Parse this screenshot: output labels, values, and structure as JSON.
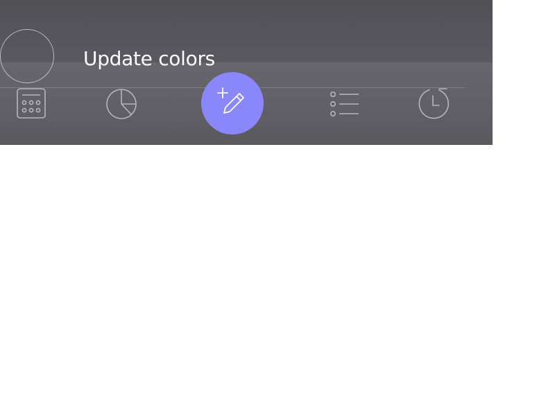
{
  "tooltip": {
    "label": "Update colors"
  },
  "colors": {
    "accent": "#8a87fb",
    "icon_stroke": "#b7b6bb",
    "panel_background": "#5e5d63"
  },
  "tab_bar": {
    "tabs": [
      {
        "name": "calculator-tab",
        "icon": "calculator-icon"
      },
      {
        "name": "statistics-tab",
        "icon": "pie-chart-icon"
      },
      {
        "name": "add-entry-tab",
        "icon": "add-edit-icon"
      },
      {
        "name": "list-tab",
        "icon": "list-icon"
      },
      {
        "name": "history-tab",
        "icon": "history-icon"
      }
    ]
  }
}
